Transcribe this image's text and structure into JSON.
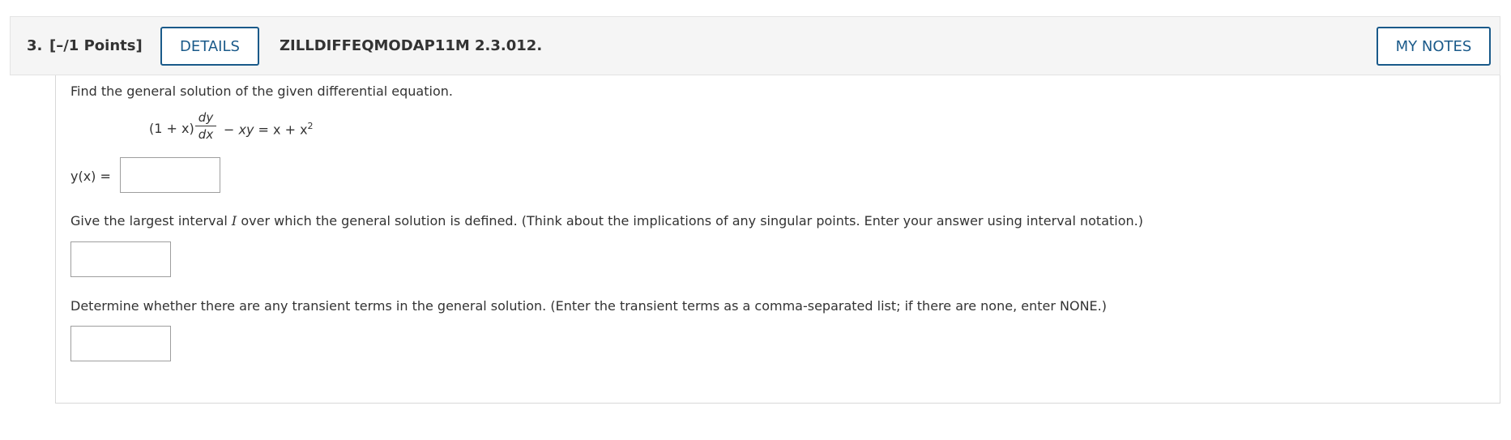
{
  "question": {
    "number": "3.",
    "points": "[–/1 Points]",
    "details_button": "DETAILS",
    "problem_id": "ZILLDIFFEQMODAP11M 2.3.012.",
    "notes_button": "MY NOTES"
  },
  "content": {
    "prompt1": "Find the general solution of the given differential equation.",
    "equation": {
      "left": "(1 + x)",
      "frac_num": "dy",
      "frac_den": "dx",
      "right_op": " − ",
      "right_term": "xy",
      "right_rest": " = x + x",
      "right_exp": "2"
    },
    "answer_label": "y(x) =",
    "answer1_value": "",
    "prompt2_before": "Give the largest interval ",
    "prompt2_var": "I",
    "prompt2_after": " over which the general solution is defined. (Think about the implications of any singular points. Enter your answer using interval notation.)",
    "answer2_value": "",
    "prompt3": "Determine whether there are any transient terms in the general solution. (Enter the transient terms as a comma-separated list; if there are none, enter NONE.)",
    "answer3_value": ""
  },
  "colors": {
    "accent": "#1a5a8a",
    "header_bg": "#f5f5f5",
    "text": "#333333"
  }
}
